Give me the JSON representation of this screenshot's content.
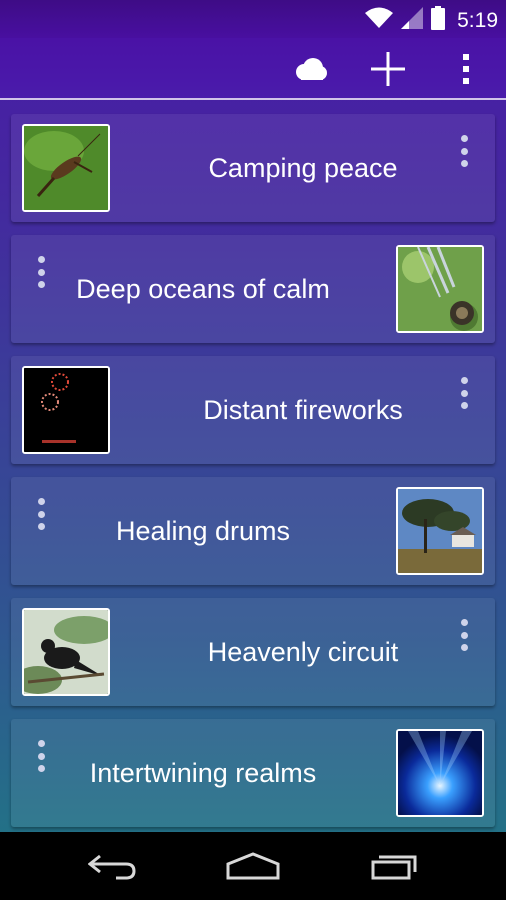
{
  "status_bar": {
    "time": "5:19",
    "icons": [
      "wifi-icon",
      "signal-icon",
      "battery-icon"
    ]
  },
  "action_bar": {
    "icons": [
      "cloud-icon",
      "add-icon",
      "overflow-menu-icon"
    ]
  },
  "sounds": [
    {
      "title": "Camping peace",
      "thumbnail": "cricket-insect-photo",
      "thumb_side": "left"
    },
    {
      "title": "Deep oceans of calm",
      "thumbnail": "wind-chime-photo",
      "thumb_side": "right"
    },
    {
      "title": "Distant fireworks",
      "thumbnail": "fireworks-photo",
      "thumb_side": "left"
    },
    {
      "title": "Healing drums",
      "thumbnail": "coastal-trees-photo",
      "thumb_side": "right"
    },
    {
      "title": "Heavenly circuit",
      "thumbnail": "blackbird-photo",
      "thumb_side": "left"
    },
    {
      "title": "Intertwining realms",
      "thumbnail": "blue-light-rays-photo",
      "thumb_side": "right"
    }
  ],
  "nav_bar": {
    "icons": [
      "back-icon",
      "home-icon",
      "recent-apps-icon"
    ]
  },
  "colors": {
    "gradient_top": "#4a1aa8",
    "gradient_bottom": "#1f7a84",
    "nav_background": "#000000"
  }
}
